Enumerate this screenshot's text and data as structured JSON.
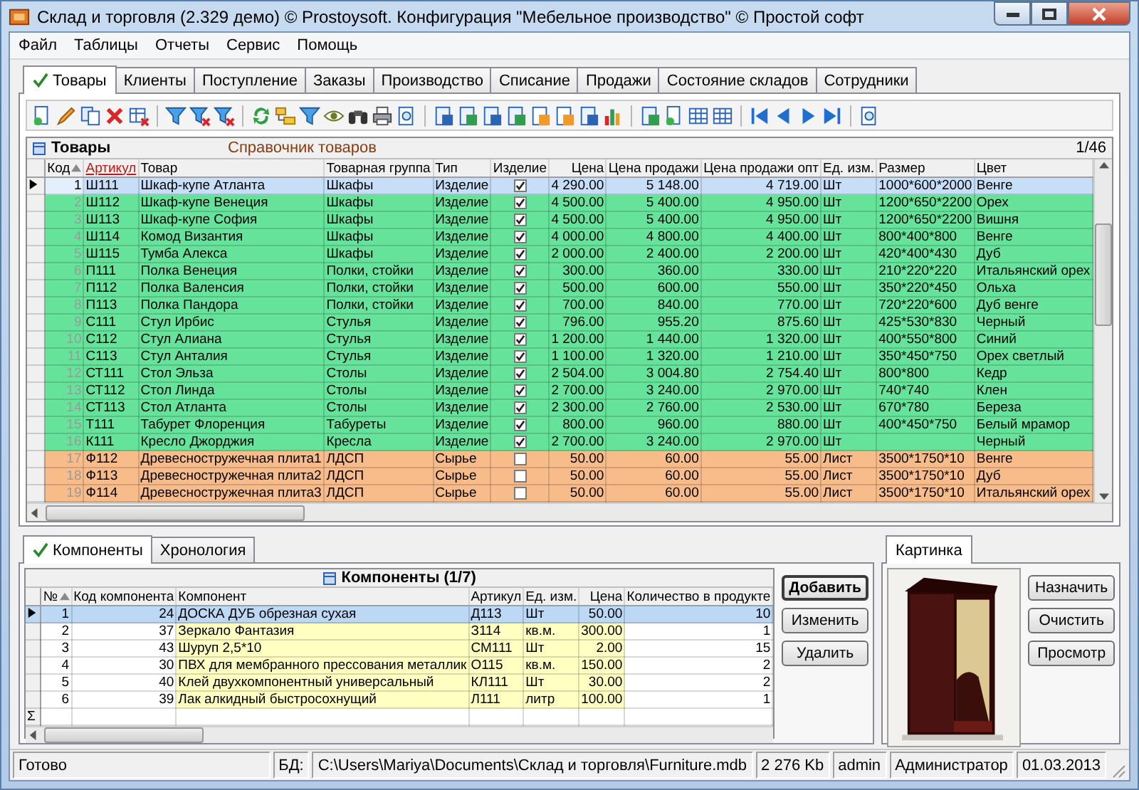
{
  "window": {
    "title": "Склад и торговля (2.329 демо) © Prostoysoft. Конфигурация \"Мебельное производство\" © Простой софт"
  },
  "menu": [
    "Файл",
    "Таблицы",
    "Отчеты",
    "Сервис",
    "Помощь"
  ],
  "tabs": [
    {
      "label": "Товары",
      "selected": true
    },
    {
      "label": "Клиенты",
      "selected": false
    },
    {
      "label": "Поступление",
      "selected": false
    },
    {
      "label": "Заказы",
      "selected": false
    },
    {
      "label": "Производство",
      "selected": false
    },
    {
      "label": "Списание",
      "selected": false
    },
    {
      "label": "Продажи",
      "selected": false
    },
    {
      "label": "Состояние складов",
      "selected": false
    },
    {
      "label": "Сотрудники",
      "selected": false
    }
  ],
  "products": {
    "title": "Товары",
    "subtitle": "Справочник товаров",
    "position": "1/46",
    "columns": [
      {
        "label": "Код",
        "sorted": true,
        "highlighted": false
      },
      {
        "label": "Артикул",
        "sorted": false,
        "highlighted": true
      },
      {
        "label": "Товар",
        "sorted": false,
        "highlighted": false
      },
      {
        "label": "Товарная группа",
        "sorted": false,
        "highlighted": false
      },
      {
        "label": "Тип",
        "sorted": false,
        "highlighted": false
      },
      {
        "label": "Изделие",
        "sorted": false,
        "highlighted": false
      },
      {
        "label": "Цена",
        "sorted": false,
        "highlighted": false
      },
      {
        "label": "Цена продажи",
        "sorted": false,
        "highlighted": false
      },
      {
        "label": "Цена продажи опт",
        "sorted": false,
        "highlighted": false
      },
      {
        "label": "Ед. изм.",
        "sorted": false,
        "highlighted": false
      },
      {
        "label": "Размер",
        "sorted": false,
        "highlighted": false
      },
      {
        "label": "Цвет",
        "sorted": false,
        "highlighted": false
      }
    ],
    "rows": [
      {
        "code": "1",
        "article": "Ш111",
        "name": "Шкаф-купе Атланта",
        "group": "Шкафы",
        "type": "Изделие",
        "checked": true,
        "price": "4 290.00",
        "sale_price": "5 148.00",
        "wholesale_price": "4 719.00",
        "unit": "Шт",
        "size": "1000*600*2000",
        "product_color": "Венге",
        "selected": true
      },
      {
        "code": "2",
        "article": "Ш112",
        "name": "Шкаф-купе Венеция",
        "group": "Шкафы",
        "type": "Изделие",
        "checked": true,
        "price": "4 500.00",
        "sale_price": "5 400.00",
        "wholesale_price": "4 950.00",
        "unit": "Шт",
        "size": "1200*650*2200",
        "product_color": "Орех",
        "color": "#66e39a",
        "selected": false
      },
      {
        "code": "3",
        "article": "Ш113",
        "name": "Шкаф-купе София",
        "group": "Шкафы",
        "type": "Изделие",
        "checked": true,
        "price": "4 500.00",
        "sale_price": "5 400.00",
        "wholesale_price": "4 950.00",
        "unit": "Шт",
        "size": "1200*650*2200",
        "product_color": "Вишня",
        "color": "#66e39a",
        "selected": false
      },
      {
        "code": "4",
        "article": "Ш114",
        "name": "Комод Византия",
        "group": "Шкафы",
        "type": "Изделие",
        "checked": true,
        "price": "4 000.00",
        "sale_price": "4 800.00",
        "wholesale_price": "4 400.00",
        "unit": "Шт",
        "size": "800*400*800",
        "product_color": "Венге",
        "color": "#66e39a",
        "selected": false
      },
      {
        "code": "5",
        "article": "Ш115",
        "name": "Тумба Алекса",
        "group": "Шкафы",
        "type": "Изделие",
        "checked": true,
        "price": "2 000.00",
        "sale_price": "2 400.00",
        "wholesale_price": "2 200.00",
        "unit": "Шт",
        "size": "420*400*430",
        "product_color": "Дуб",
        "color": "#66e39a",
        "selected": false
      },
      {
        "code": "6",
        "article": "П111",
        "name": "Полка Венеция",
        "group": "Полки, стойки",
        "type": "Изделие",
        "checked": true,
        "price": "300.00",
        "sale_price": "360.00",
        "wholesale_price": "330.00",
        "unit": "Шт",
        "size": "210*220*220",
        "product_color": "Итальянский орех",
        "color": "#66e39a",
        "selected": false
      },
      {
        "code": "7",
        "article": "П112",
        "name": "Полка Валенсия",
        "group": "Полки, стойки",
        "type": "Изделие",
        "checked": true,
        "price": "500.00",
        "sale_price": "600.00",
        "wholesale_price": "550.00",
        "unit": "Шт",
        "size": "350*220*450",
        "product_color": "Ольха",
        "color": "#66e39a",
        "selected": false
      },
      {
        "code": "8",
        "article": "П113",
        "name": "Полка Пандора",
        "group": "Полки, стойки",
        "type": "Изделие",
        "checked": true,
        "price": "700.00",
        "sale_price": "840.00",
        "wholesale_price": "770.00",
        "unit": "Шт",
        "size": "720*220*600",
        "product_color": "Дуб венге",
        "color": "#66e39a",
        "selected": false
      },
      {
        "code": "9",
        "article": "С111",
        "name": "Стул Ирбис",
        "group": "Стулья",
        "type": "Изделие",
        "checked": true,
        "price": "796.00",
        "sale_price": "955.20",
        "wholesale_price": "875.60",
        "unit": "Шт",
        "size": "425*530*830",
        "product_color": "Черный",
        "color": "#66e39a",
        "selected": false
      },
      {
        "code": "10",
        "article": "С112",
        "name": "Стул Алиана",
        "group": "Стулья",
        "type": "Изделие",
        "checked": true,
        "price": "1 200.00",
        "sale_price": "1 440.00",
        "wholesale_price": "1 320.00",
        "unit": "Шт",
        "size": "400*550*800",
        "product_color": "Синий",
        "color": "#66e39a",
        "selected": false
      },
      {
        "code": "11",
        "article": "С113",
        "name": "Стул Анталия",
        "group": "Стулья",
        "type": "Изделие",
        "checked": true,
        "price": "1 100.00",
        "sale_price": "1 320.00",
        "wholesale_price": "1 210.00",
        "unit": "Шт",
        "size": "350*450*750",
        "product_color": "Орех светлый",
        "color": "#66e39a",
        "selected": false
      },
      {
        "code": "12",
        "article": "СТ111",
        "name": "Стол Эльза",
        "group": "Столы",
        "type": "Изделие",
        "checked": true,
        "price": "2 504.00",
        "sale_price": "3 004.80",
        "wholesale_price": "2 754.40",
        "unit": "Шт",
        "size": "800*800",
        "product_color": "Кедр",
        "color": "#66e39a",
        "selected": false
      },
      {
        "code": "13",
        "article": "СТ112",
        "name": "Стол Линда",
        "group": "Столы",
        "type": "Изделие",
        "checked": true,
        "price": "2 700.00",
        "sale_price": "3 240.00",
        "wholesale_price": "2 970.00",
        "unit": "Шт",
        "size": "740*740",
        "product_color": "Клен",
        "color": "#66e39a",
        "selected": false
      },
      {
        "code": "14",
        "article": "СТ113",
        "name": "Стол Атланта",
        "group": "Столы",
        "type": "Изделие",
        "checked": true,
        "price": "2 300.00",
        "sale_price": "2 760.00",
        "wholesale_price": "2 530.00",
        "unit": "Шт",
        "size": "670*780",
        "product_color": "Береза",
        "color": "#66e39a",
        "selected": false
      },
      {
        "code": "15",
        "article": "Т111",
        "name": "Табурет Флоренция",
        "group": "Табуреты",
        "type": "Изделие",
        "checked": true,
        "price": "800.00",
        "sale_price": "960.00",
        "wholesale_price": "880.00",
        "unit": "Шт",
        "size": "400*450*750",
        "product_color": "Белый мрамор",
        "color": "#66e39a",
        "selected": false
      },
      {
        "code": "16",
        "article": "К111",
        "name": "Кресло Джорджия",
        "group": "Кресла",
        "type": "Изделие",
        "checked": true,
        "price": "2 700.00",
        "sale_price": "3 240.00",
        "wholesale_price": "2 970.00",
        "unit": "Шт",
        "product_color": "Черный",
        "color": "#66e39a",
        "selected": false
      },
      {
        "code": "17",
        "article": "Ф112",
        "name": "Древесностружечная плита1",
        "group": "ЛДСП",
        "type": "Сырье",
        "checked": false,
        "price": "50.00",
        "sale_price": "60.00",
        "wholesale_price": "55.00",
        "unit": "Лист",
        "size": "3500*1750*10",
        "product_color": "Венге",
        "color": "#f8bb8a",
        "selected": false
      },
      {
        "code": "18",
        "article": "Ф113",
        "name": "Древесностружечная плита2",
        "group": "ЛДСП",
        "type": "Сырье",
        "checked": false,
        "price": "50.00",
        "sale_price": "60.00",
        "wholesale_price": "55.00",
        "unit": "Лист",
        "size": "3500*1750*10",
        "product_color": "Дуб",
        "color": "#f8bb8a",
        "selected": false
      },
      {
        "code": "19",
        "article": "Ф114",
        "name": "Древесностружечная плита3",
        "group": "ЛДСП",
        "type": "Сырье",
        "checked": false,
        "price": "50.00",
        "sale_price": "60.00",
        "wholesale_price": "55.00",
        "unit": "Лист",
        "size": "3500*1750*10",
        "product_color": "Итальянский орех",
        "color": "#f8bb8a",
        "selected": false
      }
    ]
  },
  "detail_tabs": [
    {
      "label": "Компоненты",
      "selected": true
    },
    {
      "label": "Хронология",
      "selected": false
    }
  ],
  "components": {
    "title": "Компоненты (1/7)",
    "columns": [
      {
        "label": "№",
        "sorted": true
      },
      {
        "label": "Код компонента",
        "sorted": false
      },
      {
        "label": "Компонент",
        "sorted": false
      },
      {
        "label": "Артикул",
        "sorted": false
      },
      {
        "label": "Ед. изм.",
        "sorted": false
      },
      {
        "label": "Цена",
        "sorted": false
      },
      {
        "label": "Количество в продукте",
        "sorted": false
      }
    ],
    "rows": [
      {
        "number": "1",
        "code": "24",
        "name": "ДОСКА ДУБ обрезная сухая",
        "article": "Д113",
        "unit": "Шт",
        "price": "50.00",
        "quantity": "10",
        "selected": true
      },
      {
        "number": "2",
        "code": "37",
        "name": "Зеркало Фантазия",
        "article": "З114",
        "unit": "кв.м.",
        "price": "300.00",
        "quantity": "1",
        "selected": false
      },
      {
        "number": "3",
        "code": "43",
        "name": "Шуруп 2,5*10",
        "article": "СМ111",
        "unit": "Шт",
        "price": "2.00",
        "quantity": "15",
        "selected": false
      },
      {
        "number": "4",
        "code": "30",
        "name": "ПВХ для мембранного прессования металлик",
        "article": "О115",
        "unit": "кв.м.",
        "price": "150.00",
        "quantity": "2",
        "selected": false
      },
      {
        "number": "5",
        "code": "40",
        "name": "Клей двухкомпонентный универсальный",
        "article": "КЛ111",
        "unit": "Шт",
        "price": "30.00",
        "quantity": "2",
        "selected": false
      },
      {
        "number": "6",
        "code": "39",
        "name": "Лак алкидный быстросохнущий",
        "article": "Л111",
        "unit": "литр",
        "price": "100.00",
        "quantity": "1",
        "selected": false
      }
    ],
    "total_mark": "Σ",
    "buttons": [
      {
        "label": "Добавить",
        "default": true
      },
      {
        "label": "Изменить",
        "default": false
      },
      {
        "label": "Удалить",
        "default": false
      }
    ]
  },
  "picture_panel": {
    "tab": "Картинка",
    "buttons": [
      "Назначить",
      "Очистить",
      "Просмотр"
    ]
  },
  "status_bar": {
    "status": "Готово",
    "db_label": "БД:",
    "db_path": "C:\\Users\\Mariya\\Documents\\Склад и торговля\\Furniture.mdb",
    "db_size": "2 276 Kb",
    "user": "admin",
    "role": "Администратор",
    "date": "01.03.2013"
  }
}
